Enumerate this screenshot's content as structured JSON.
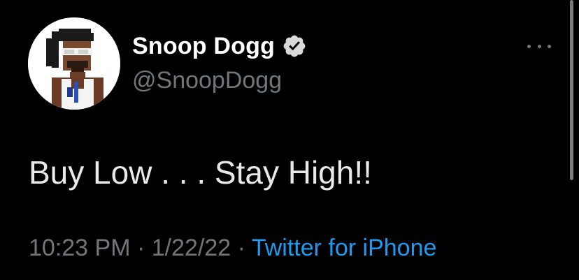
{
  "author": {
    "display_name": "Snoop Dogg",
    "handle": "@SnoopDogg",
    "verified": true,
    "avatar_icon": "pixel-character-avatar-icon"
  },
  "tweet": {
    "text": "Buy Low . . . Stay High!!",
    "time": "10:23 PM",
    "separator": "·",
    "date": "1/22/22",
    "source": "Twitter for iPhone"
  },
  "colors": {
    "background": "#000000",
    "primary_text": "#e7e9ea",
    "secondary_text": "#71767b",
    "link": "#1d9bf0",
    "verified_badge": "#d9d9d9"
  }
}
